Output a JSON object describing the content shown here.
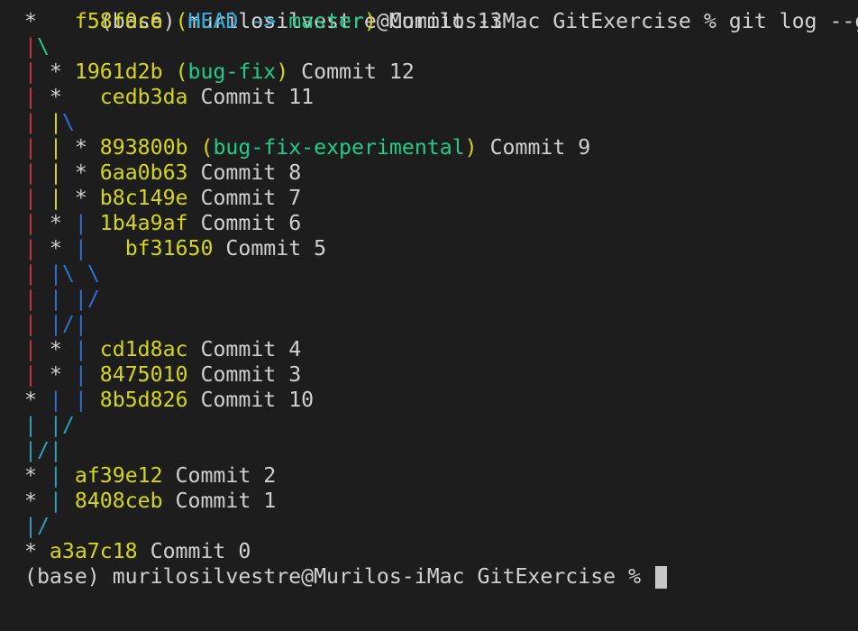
{
  "colors": {
    "background": "#1d1d1d",
    "text": "#d0d0d0",
    "hash": "#d6d619",
    "head": "#2eaee0",
    "branch": "#22cc88",
    "graph_red": "#c8343a",
    "graph_yellow": "#d6d619",
    "graph_blue": "#2f6fd6",
    "graph_cyan": "#2e9fc0",
    "cursor": "#c8c8c8"
  },
  "terminal": {
    "top_command": "(base) murilosilvestre@Murilos-iMac GitExercise % git log --graph",
    "prompt": "(base) murilosilvestre@Murilos-iMac GitExercise % ",
    "lines": [
      [
        {
          "t": "*   ",
          "c": "text"
        },
        {
          "t": "f58f0c6 ",
          "c": "hash"
        },
        {
          "t": "(",
          "c": "hash"
        },
        {
          "t": "HEAD -> ",
          "c": "head"
        },
        {
          "t": "master",
          "c": "branch"
        },
        {
          "t": ")",
          "c": "hash"
        },
        {
          "t": " Commit 13",
          "c": "text"
        }
      ],
      [
        {
          "t": "|",
          "c": "graph_red"
        },
        {
          "t": "\\",
          "c": "branch"
        }
      ],
      [
        {
          "t": "|",
          "c": "graph_red"
        },
        {
          "t": " * ",
          "c": "text"
        },
        {
          "t": "1961d2b ",
          "c": "hash"
        },
        {
          "t": "(",
          "c": "hash"
        },
        {
          "t": "bug-fix",
          "c": "branch"
        },
        {
          "t": ")",
          "c": "hash"
        },
        {
          "t": " Commit 12",
          "c": "text"
        }
      ],
      [
        {
          "t": "|",
          "c": "graph_red"
        },
        {
          "t": " *   ",
          "c": "text"
        },
        {
          "t": "cedb3da",
          "c": "hash"
        },
        {
          "t": " Commit 11",
          "c": "text"
        }
      ],
      [
        {
          "t": "|",
          "c": "graph_red"
        },
        {
          "t": " ",
          "c": "text"
        },
        {
          "t": "|",
          "c": "graph_yellow"
        },
        {
          "t": "\\",
          "c": "graph_blue"
        }
      ],
      [
        {
          "t": "|",
          "c": "graph_red"
        },
        {
          "t": " ",
          "c": "text"
        },
        {
          "t": "|",
          "c": "graph_yellow"
        },
        {
          "t": " * ",
          "c": "text"
        },
        {
          "t": "893800b ",
          "c": "hash"
        },
        {
          "t": "(",
          "c": "hash"
        },
        {
          "t": "bug-fix-experimental",
          "c": "branch"
        },
        {
          "t": ")",
          "c": "hash"
        },
        {
          "t": " Commit 9",
          "c": "text"
        }
      ],
      [
        {
          "t": "|",
          "c": "graph_red"
        },
        {
          "t": " ",
          "c": "text"
        },
        {
          "t": "|",
          "c": "graph_yellow"
        },
        {
          "t": " * ",
          "c": "text"
        },
        {
          "t": "6aa0b63",
          "c": "hash"
        },
        {
          "t": " Commit 8",
          "c": "text"
        }
      ],
      [
        {
          "t": "|",
          "c": "graph_red"
        },
        {
          "t": " ",
          "c": "text"
        },
        {
          "t": "|",
          "c": "graph_yellow"
        },
        {
          "t": " * ",
          "c": "text"
        },
        {
          "t": "b8c149e",
          "c": "hash"
        },
        {
          "t": " Commit 7",
          "c": "text"
        }
      ],
      [
        {
          "t": "|",
          "c": "graph_red"
        },
        {
          "t": " * ",
          "c": "text"
        },
        {
          "t": "|",
          "c": "graph_blue"
        },
        {
          "t": " ",
          "c": "text"
        },
        {
          "t": "1b4a9af",
          "c": "hash"
        },
        {
          "t": " Commit 6",
          "c": "text"
        }
      ],
      [
        {
          "t": "|",
          "c": "graph_red"
        },
        {
          "t": " * ",
          "c": "text"
        },
        {
          "t": "|",
          "c": "graph_blue"
        },
        {
          "t": "   ",
          "c": "text"
        },
        {
          "t": "bf31650",
          "c": "hash"
        },
        {
          "t": " Commit 5",
          "c": "text"
        }
      ],
      [
        {
          "t": "|",
          "c": "graph_red"
        },
        {
          "t": " ",
          "c": "text"
        },
        {
          "t": "|\\ \\",
          "c": "graph_blue"
        }
      ],
      [
        {
          "t": "|",
          "c": "graph_red"
        },
        {
          "t": " ",
          "c": "text"
        },
        {
          "t": "| |/",
          "c": "graph_blue"
        }
      ],
      [
        {
          "t": "|",
          "c": "graph_red"
        },
        {
          "t": " ",
          "c": "text"
        },
        {
          "t": "|/|",
          "c": "graph_blue"
        }
      ],
      [
        {
          "t": "|",
          "c": "graph_red"
        },
        {
          "t": " * ",
          "c": "text"
        },
        {
          "t": "|",
          "c": "graph_blue"
        },
        {
          "t": " ",
          "c": "text"
        },
        {
          "t": "cd1d8ac",
          "c": "hash"
        },
        {
          "t": " Commit 4",
          "c": "text"
        }
      ],
      [
        {
          "t": "|",
          "c": "graph_red"
        },
        {
          "t": " * ",
          "c": "text"
        },
        {
          "t": "|",
          "c": "graph_blue"
        },
        {
          "t": " ",
          "c": "text"
        },
        {
          "t": "8475010",
          "c": "hash"
        },
        {
          "t": " Commit 3",
          "c": "text"
        }
      ],
      [
        {
          "t": "* ",
          "c": "text"
        },
        {
          "t": "|",
          "c": "graph_blue"
        },
        {
          "t": " ",
          "c": "text"
        },
        {
          "t": "|",
          "c": "graph_blue"
        },
        {
          "t": " ",
          "c": "text"
        },
        {
          "t": "8b5d826",
          "c": "hash"
        },
        {
          "t": " Commit 10",
          "c": "text"
        }
      ],
      [
        {
          "t": "| |/",
          "c": "graph_cyan"
        }
      ],
      [
        {
          "t": "|/|",
          "c": "graph_cyan"
        }
      ],
      [
        {
          "t": "* ",
          "c": "text"
        },
        {
          "t": "|",
          "c": "graph_cyan"
        },
        {
          "t": " ",
          "c": "text"
        },
        {
          "t": "af39e12",
          "c": "hash"
        },
        {
          "t": " Commit 2",
          "c": "text"
        }
      ],
      [
        {
          "t": "* ",
          "c": "text"
        },
        {
          "t": "|",
          "c": "graph_cyan"
        },
        {
          "t": " ",
          "c": "text"
        },
        {
          "t": "8408ceb",
          "c": "hash"
        },
        {
          "t": " Commit 1",
          "c": "text"
        }
      ],
      [
        {
          "t": "|/",
          "c": "graph_cyan"
        }
      ],
      [
        {
          "t": "* ",
          "c": "text"
        },
        {
          "t": "a3a7c18",
          "c": "hash"
        },
        {
          "t": " Commit 0",
          "c": "text"
        }
      ]
    ]
  }
}
